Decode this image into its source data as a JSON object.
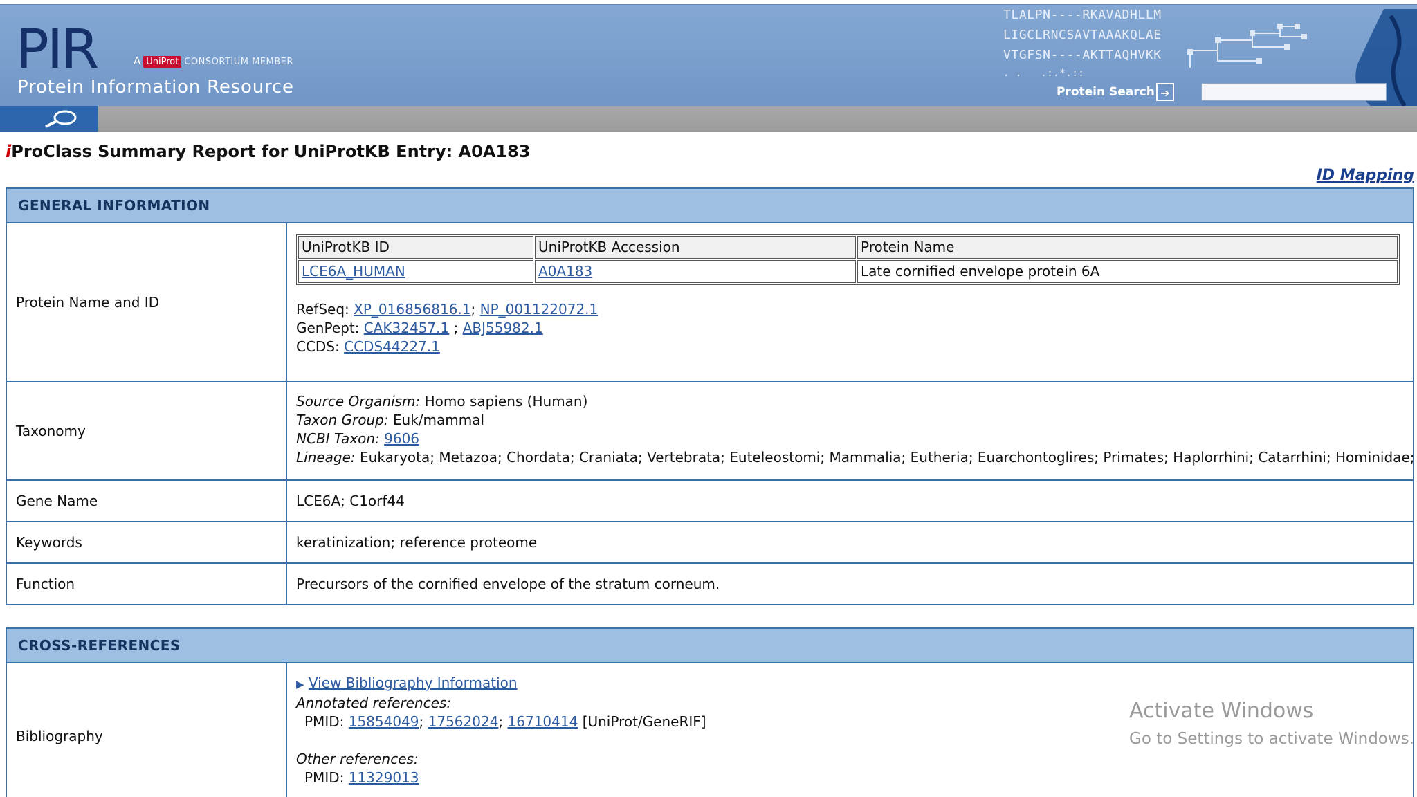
{
  "header": {
    "logo": "PIR",
    "member_prefix": "A",
    "uniprot_badge": "UniProt",
    "consortium": "CONSORTIUM MEMBER",
    "subtitle": "Protein Information Resource",
    "sequence_lines": [
      "TLALPN----RKAVADHLLM",
      "LIGCLRNCSAVTAAAKQLAE",
      "VTGFSN----AKTTAQHVKK",
      ". .   .:.*.::"
    ],
    "search_label": "Protein Search",
    "search_value": ""
  },
  "page": {
    "title_i": "i",
    "title": "ProClass Summary Report for UniProtKB Entry: A0A183",
    "id_mapping": "ID Mapping"
  },
  "general": {
    "heading": "GENERAL INFORMATION",
    "protein_label": "Protein Name and ID",
    "id_table": {
      "headers": [
        "UniProtKB ID",
        "UniProtKB Accession",
        "Protein Name"
      ],
      "row": [
        "LCE6A_HUMAN",
        "A0A183",
        "Late cornified envelope protein 6A"
      ]
    },
    "refseq_label": "RefSeq:",
    "refseq": [
      "XP_016856816.1",
      "NP_001122072.1"
    ],
    "genpept_label": "GenPept:",
    "genpept": [
      "CAK32457.1",
      "ABJ55982.1"
    ],
    "ccds_label": "CCDS:",
    "ccds": "CCDS44227.1",
    "taxonomy_label": "Taxonomy",
    "source_label": "Source Organism:",
    "source": "Homo sapiens (Human)",
    "taxon_group_label": "Taxon Group:",
    "taxon_group": "Euk/mammal",
    "ncbi_label": "NCBI Taxon:",
    "ncbi": "9606",
    "lineage_label": "Lineage:",
    "lineage": "Eukaryota; Metazoa; Chordata; Craniata; Vertebrata; Euteleostomi; Mammalia; Eutheria; Euarchontoglires; Primates; Haplorrhini; Catarrhini; Hominidae; Homo.",
    "gene_label": "Gene Name",
    "gene": "LCE6A; C1orf44",
    "keywords_label": "Keywords",
    "keywords": "keratinization; reference proteome",
    "function_label": "Function",
    "function": "Precursors of the cornified envelope of the stratum corneum."
  },
  "xref": {
    "heading": "CROSS-REFERENCES",
    "biblio_label": "Bibliography",
    "view_biblio": "View Bibliography Information",
    "annotated_label": "Annotated references:",
    "pmid_label": "PMID:",
    "annotated_pmids": [
      "15854049",
      "17562024",
      "16710414"
    ],
    "annotated_source": "[UniProt/GeneRIF]",
    "other_label": "Other references:",
    "other_pmid": "11329013"
  },
  "watermark": {
    "line1": "Activate Windows",
    "line2": "Go to Settings to activate Windows."
  }
}
